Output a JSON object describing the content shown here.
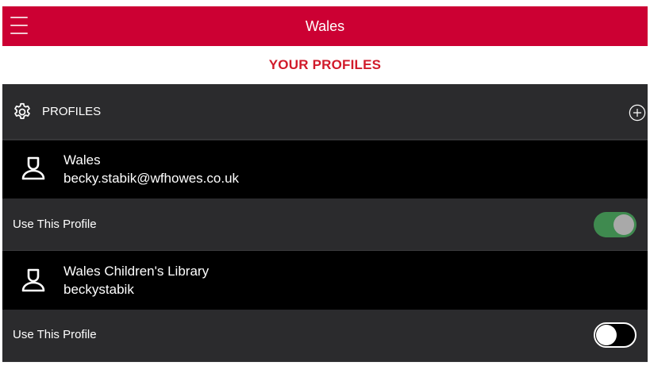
{
  "topbar": {
    "title": "Wales",
    "menu_icon": "hamburger-menu-icon"
  },
  "page": {
    "heading": "YOUR PROFILES"
  },
  "section": {
    "title": "PROFILES",
    "icon": "gear-icon",
    "add_icon": "plus-circle-icon"
  },
  "profiles": [
    {
      "name": "Wales",
      "account": "becky.stabik@wfhowes.co.uk",
      "toggle_label": "Use This Profile",
      "active": true
    },
    {
      "name": "Wales Children's Library",
      "account": "beckystabik",
      "toggle_label": "Use This Profile",
      "active": false
    }
  ],
  "colors": {
    "brand_red": "#cc0033",
    "heading_red": "#d11a2a",
    "panel_bg": "#2b2b2d",
    "row_bg": "#000000",
    "toggle_on": "#3f8a4f"
  }
}
